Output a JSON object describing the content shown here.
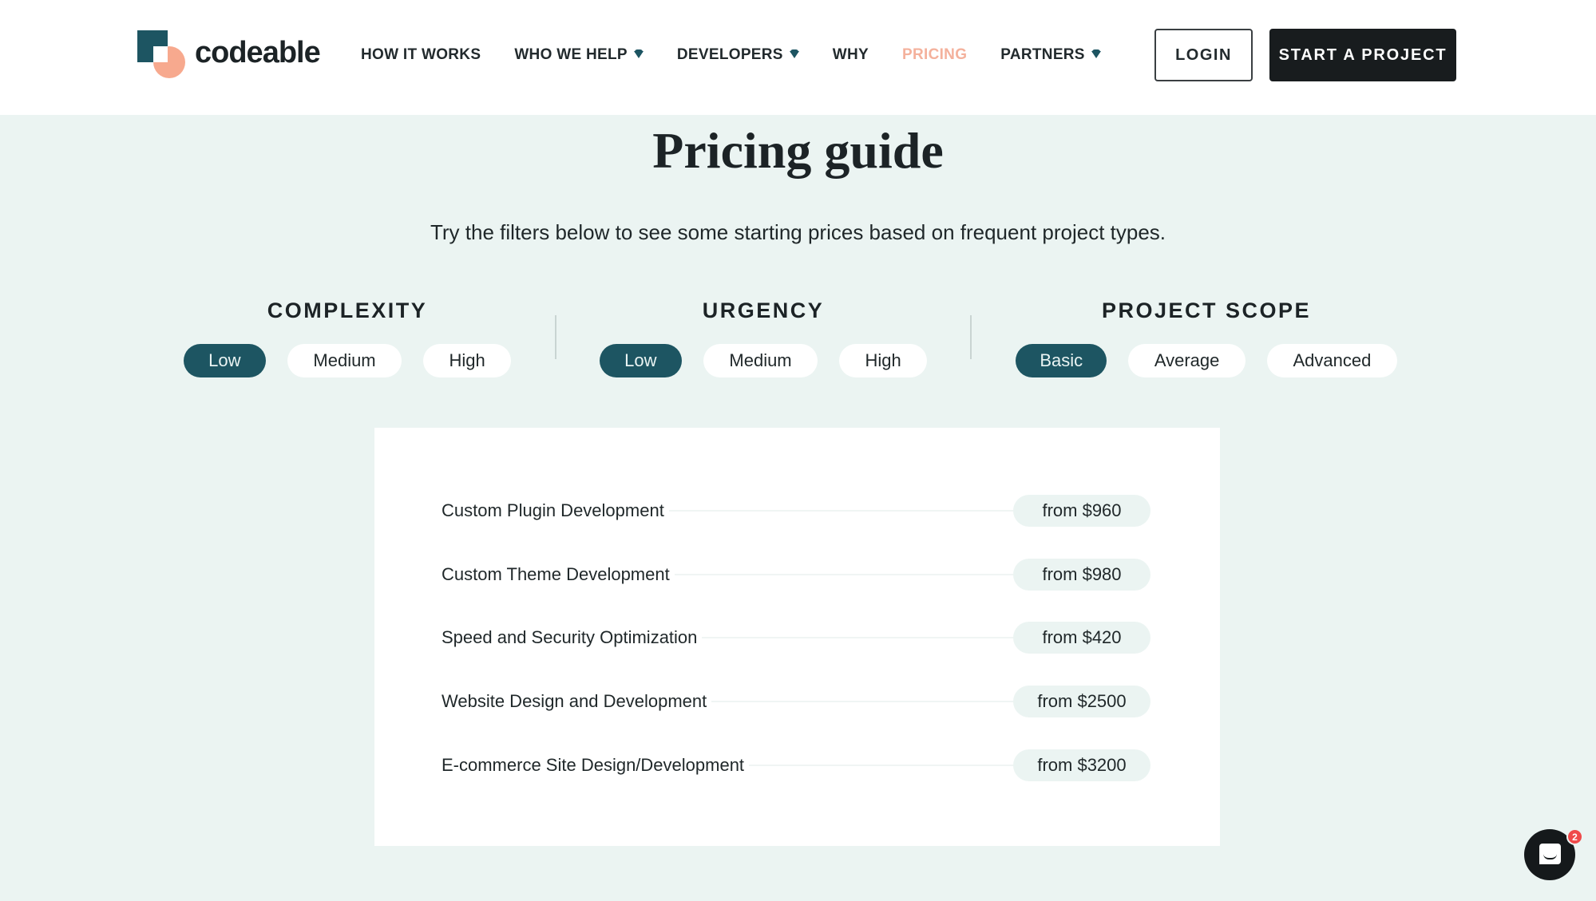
{
  "brand": {
    "name": "codeable",
    "colors": {
      "primary": "#1d5562",
      "accent": "#f7a98e",
      "dark": "#181c1e",
      "background": "#ebf4f2"
    }
  },
  "nav": {
    "items": [
      {
        "label": "HOW IT WORKS",
        "dropdown": false,
        "active": false
      },
      {
        "label": "WHO WE HELP",
        "dropdown": true,
        "active": false
      },
      {
        "label": "DEVELOPERS",
        "dropdown": true,
        "active": false
      },
      {
        "label": "WHY",
        "dropdown": false,
        "active": false
      },
      {
        "label": "PRICING",
        "dropdown": false,
        "active": true
      },
      {
        "label": "PARTNERS",
        "dropdown": true,
        "active": false
      }
    ],
    "login_label": "LOGIN",
    "start_label": "START A PROJECT"
  },
  "page": {
    "title": "Pricing guide",
    "subtitle": "Try the filters below to see some starting prices based on frequent project types."
  },
  "filters": [
    {
      "title": "COMPLEXITY",
      "options": [
        "Low",
        "Medium",
        "High"
      ],
      "selected": "Low"
    },
    {
      "title": "URGENCY",
      "options": [
        "Low",
        "Medium",
        "High"
      ],
      "selected": "Low"
    },
    {
      "title": "PROJECT SCOPE",
      "options": [
        "Basic",
        "Average",
        "Advanced"
      ],
      "selected": "Basic"
    }
  ],
  "prices": [
    {
      "service": "Custom Plugin Development",
      "price": "from $960"
    },
    {
      "service": "Custom Theme Development",
      "price": "from $980"
    },
    {
      "service": "Speed and Security Optimization",
      "price": "from $420"
    },
    {
      "service": "Website Design and Development",
      "price": "from $2500"
    },
    {
      "service": "E-commerce Site Design/Development",
      "price": "from $3200"
    }
  ],
  "chat": {
    "icon": "chat-icon",
    "unread_count": "2"
  }
}
